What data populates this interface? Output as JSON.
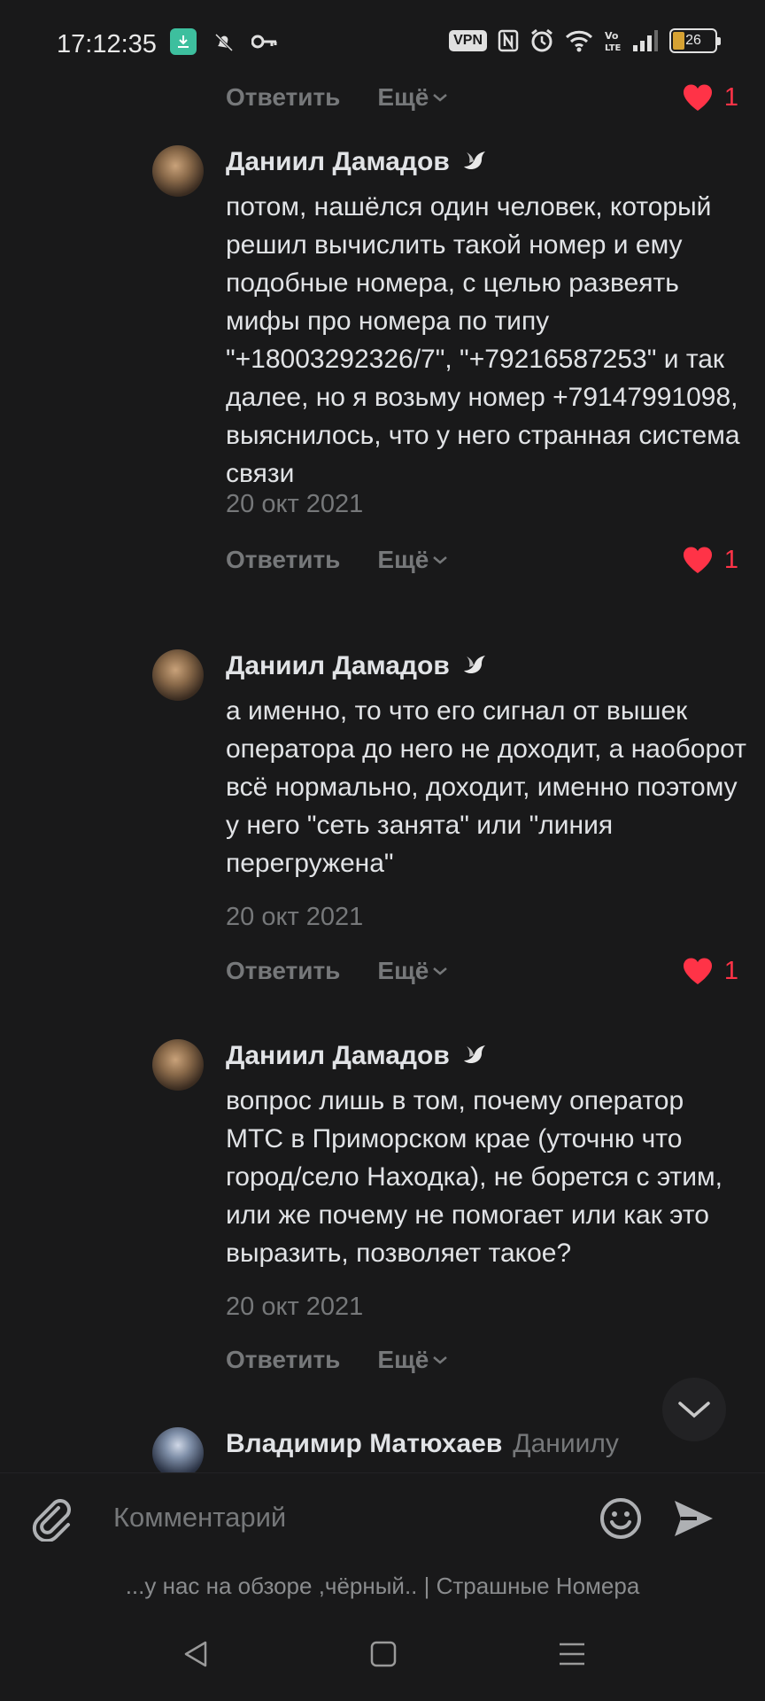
{
  "status_bar": {
    "time": "17:12:35",
    "left_icons": [
      "download-icon",
      "notification-mute-icon",
      "key-icon"
    ],
    "vpn": "VPN",
    "right_icons": [
      "nfc-icon",
      "alarm-icon",
      "wifi-icon",
      "volte-icon",
      "signal-icon"
    ],
    "battery": "26"
  },
  "comments": [
    {
      "author": "Даниил Дамадов",
      "badge_icon": "dove-icon",
      "text": "потом, нашёлся один человек, который решил вычислить такой номер и ему подобные номера, с целью развеять мифы про номера по типу \"+18003292326/7\", \"+79216587253\" и так далее, но я возьму номер +79147991098, выяснилось, что у него странная система связи",
      "date": "20 окт 2021",
      "likes": "1"
    },
    {
      "author": "Даниил Дамадов",
      "badge_icon": "dove-icon",
      "text": "а именно, то что его сигнал от вышек оператора до него не доходит, а наоборот всё нормально, доходит, именно поэтому у него \"сеть занята\" или \"линия перегружена\"",
      "date": "20 окт 2021",
      "likes": "1"
    },
    {
      "author": "Даниил Дамадов",
      "badge_icon": "dove-icon",
      "text": "вопрос лишь в том, почему оператор МТС в Приморском крае (уточню что город/село Находка), не борется с этим, или же почему не помогает или как это выразить, позволяет такое?",
      "date": "20 окт 2021",
      "likes": ""
    },
    {
      "author": "Владимир Матюхаев",
      "reply_to": "Даниилу"
    }
  ],
  "top_action": {
    "likes": "1"
  },
  "actions": {
    "reply": "Ответить",
    "more": "Ещё"
  },
  "composer": {
    "placeholder": "Комментарий"
  },
  "caption": "...у нас на обзоре ,чёрный.. | Страшные Номера",
  "colors": {
    "background": "#19191a",
    "text": "#e1e3e6",
    "secondary": "#76787a",
    "like": "#ff3347"
  }
}
